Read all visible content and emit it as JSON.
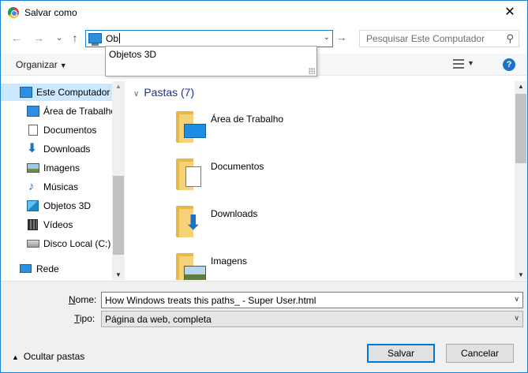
{
  "window": {
    "title": "Salvar como",
    "close_glyph": "✕"
  },
  "nav": {
    "back_glyph": "←",
    "forward_glyph": "→",
    "recent_glyph": "⌄",
    "up_glyph": "↑",
    "go_glyph": "→"
  },
  "address": {
    "value": "Ob",
    "icon": "this-pc-icon"
  },
  "autocomplete": {
    "items": [
      "Objetos 3D"
    ]
  },
  "search": {
    "placeholder": "Pesquisar Este Computador",
    "icon_glyph": "⚲"
  },
  "toolbar": {
    "organize_label": "Organizar",
    "dropdown_glyph": "▼",
    "help_glyph": "?"
  },
  "sidebar": {
    "items": [
      {
        "label": "Este Computador",
        "icon": "this-pc-icon",
        "selected": true
      },
      {
        "label": "Área de Trabalho",
        "icon": "desktop-icon"
      },
      {
        "label": "Documentos",
        "icon": "documents-icon"
      },
      {
        "label": "Downloads",
        "icon": "downloads-icon"
      },
      {
        "label": "Imagens",
        "icon": "pictures-icon"
      },
      {
        "label": "Músicas",
        "icon": "music-icon"
      },
      {
        "label": "Objetos 3D",
        "icon": "3d-objects-icon"
      },
      {
        "label": "Vídeos",
        "icon": "videos-icon"
      },
      {
        "label": "Disco Local (C:)",
        "icon": "local-disk-icon"
      },
      {
        "label": "Rede",
        "icon": "network-icon"
      }
    ]
  },
  "main": {
    "group_title": "Pastas (7)",
    "folders": [
      {
        "name": "Área de Trabalho",
        "icon": "desktop-folder-icon"
      },
      {
        "name": "Documentos",
        "icon": "documents-folder-icon"
      },
      {
        "name": "Downloads",
        "icon": "downloads-folder-icon"
      },
      {
        "name": "Imagens",
        "icon": "pictures-folder-icon"
      }
    ]
  },
  "form": {
    "name_label_prefix": "N",
    "name_label_rest": "ome:",
    "name_value": "How Windows treats this paths_ - Super User.html",
    "type_label_prefix": "T",
    "type_label_rest": "ipo:",
    "type_value": "Página da web, completa",
    "hide_folders_label": "Ocultar pastas",
    "save_label": "Salvar",
    "cancel_label": "Cancelar"
  }
}
